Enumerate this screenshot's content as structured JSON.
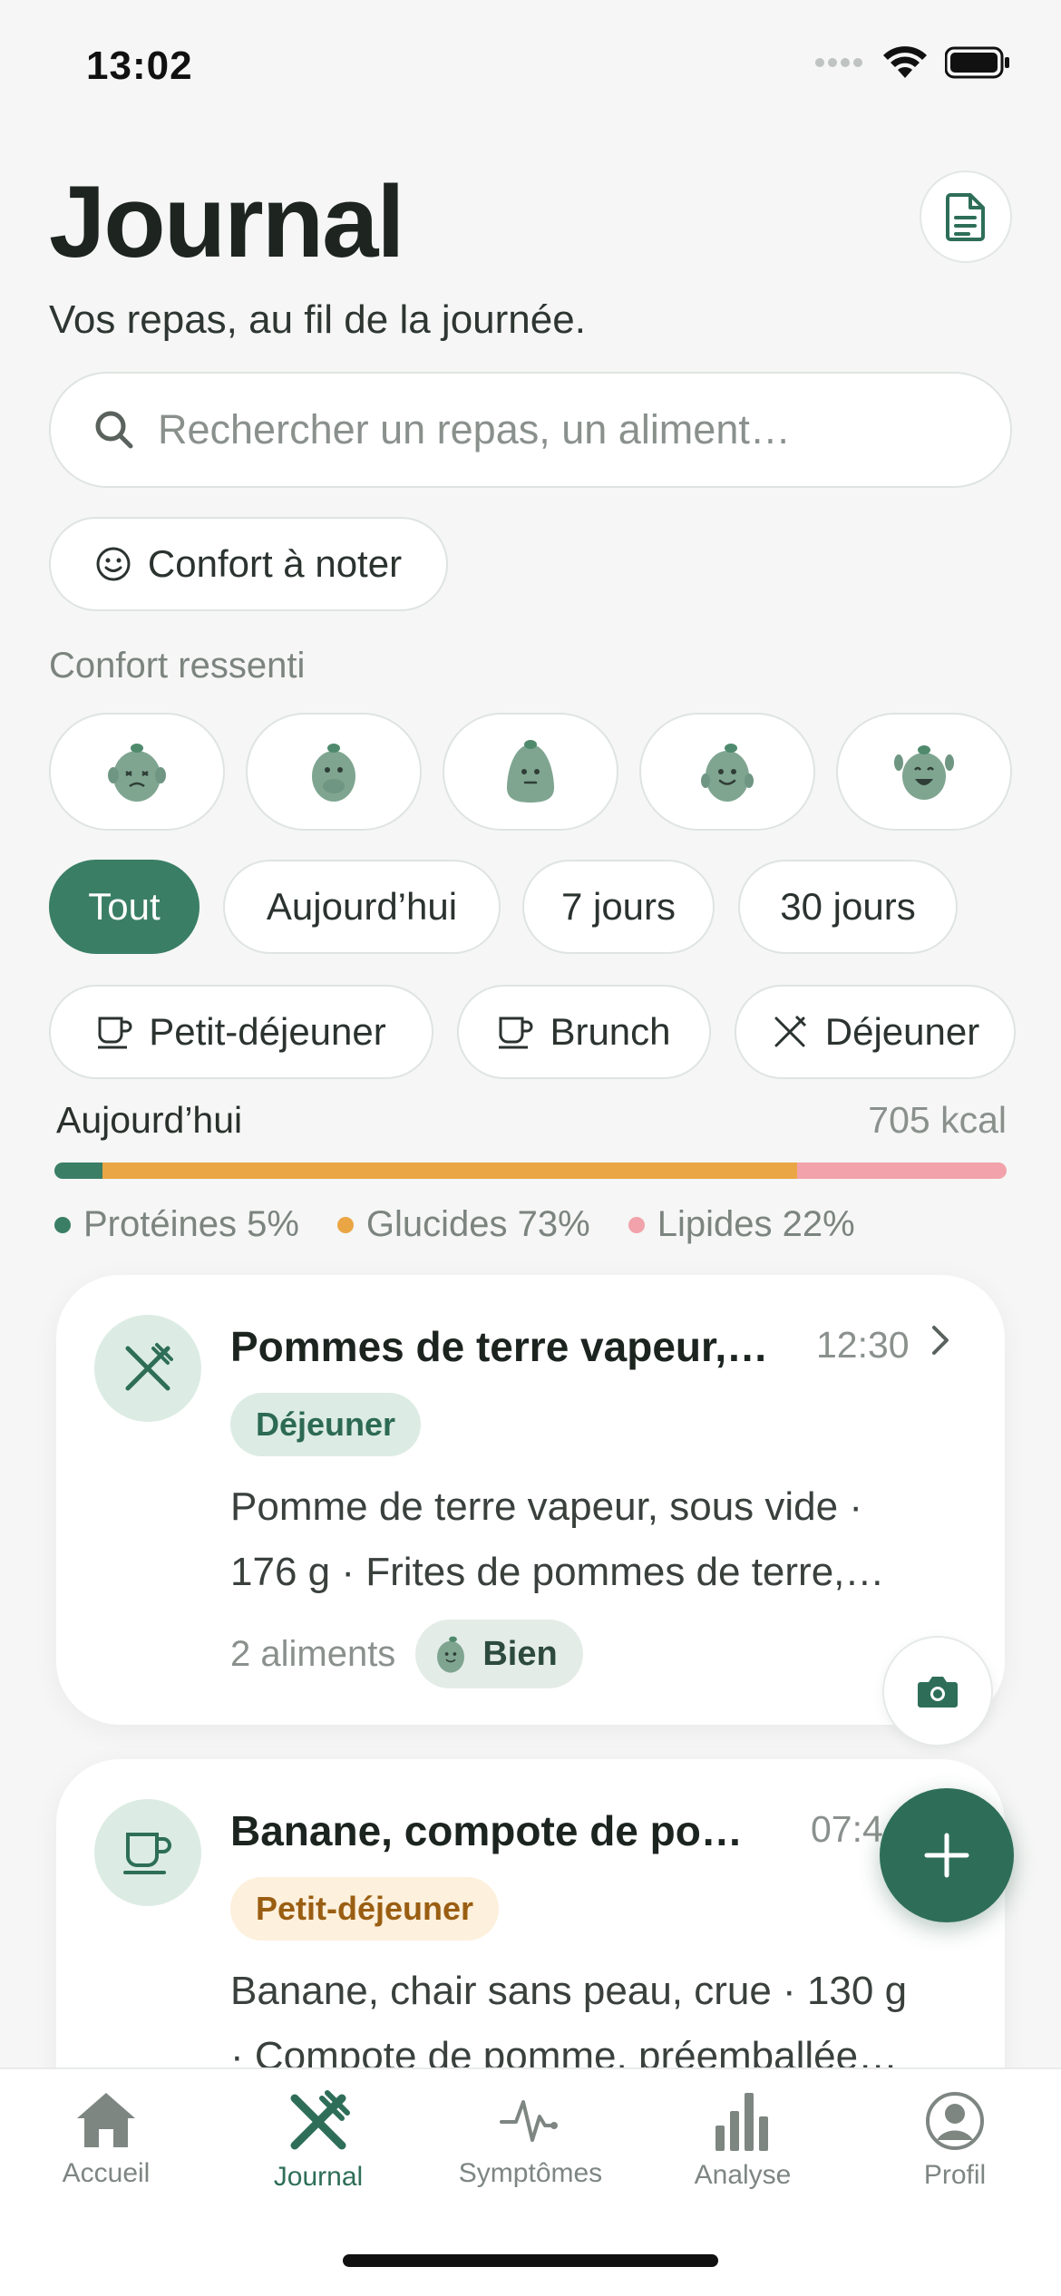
{
  "status": {
    "time": "13:02"
  },
  "header": {
    "title": "Journal",
    "subtitle": "Vos repas, au fil de la journée.",
    "doc_icon": "document-icon"
  },
  "search": {
    "placeholder": "Rechercher un repas, un aliment…"
  },
  "comfort_filter": {
    "label": "Confort à noter"
  },
  "comfort_section": {
    "label": "Confort ressenti",
    "moods": [
      "very-uncomfortable",
      "uncomfortable",
      "neutral",
      "good",
      "very-good"
    ]
  },
  "period_filters": [
    {
      "label": "Tout",
      "active": true
    },
    {
      "label": "Aujourd’hui",
      "active": false
    },
    {
      "label": "7 jours",
      "active": false
    },
    {
      "label": "30 jours",
      "active": false
    }
  ],
  "meal_filters": [
    {
      "label": "Petit-déjeuner",
      "icon": "cup-icon"
    },
    {
      "label": "Brunch",
      "icon": "cup-icon"
    },
    {
      "label": "Déjeuner",
      "icon": "utensils-icon"
    }
  ],
  "summary": {
    "label": "Aujourd’hui",
    "kcal": "705 kcal",
    "macros": [
      {
        "label": "Protéines 5%",
        "percent": 5,
        "color": "#3a7e66"
      },
      {
        "label": "Glucides 73%",
        "percent": 73,
        "color": "#eaa645"
      },
      {
        "label": "Lipides 22%",
        "percent": 22,
        "color": "#f2a2aa"
      }
    ]
  },
  "meals": [
    {
      "title": "Pommes de terre vapeur,…",
      "time": "12:30",
      "tag": "Déjeuner",
      "tag_bg": "#dcece4",
      "tag_color": "#2d6a53",
      "desc_line1": "Pomme de terre vapeur, sous vide ·",
      "desc_line2": "176 g · Frites de pommes de terre,…",
      "count": "2 aliments",
      "comfort": "Bien"
    },
    {
      "title": "Banane, compote de po…",
      "time": "07:4",
      "tag": "Petit-déjeuner",
      "tag_bg": "#fdf0dc",
      "tag_color": "#9a5e12",
      "desc_line1": "Banane, chair sans peau, crue · 130 g",
      "desc_line2": "· Compote de pomme, préemballée…"
    }
  ],
  "tabbar": [
    {
      "label": "Accueil",
      "icon": "home-icon",
      "active": false
    },
    {
      "label": "Journal",
      "icon": "utensils-icon",
      "active": true
    },
    {
      "label": "Symptômes",
      "icon": "pulse-icon",
      "active": false
    },
    {
      "label": "Analyse",
      "icon": "bar-chart-icon",
      "active": false
    },
    {
      "label": "Profil",
      "icon": "profile-icon",
      "active": false
    }
  ],
  "colors": {
    "accent": "#3a7e66",
    "accent_dark": "#2e6e58"
  }
}
